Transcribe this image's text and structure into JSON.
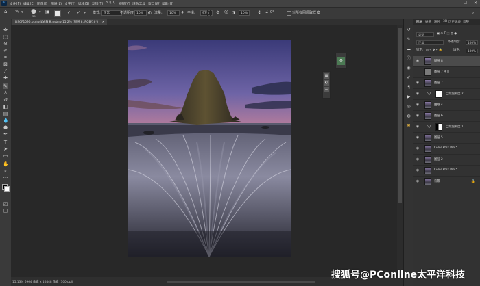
{
  "app": {
    "logo": "Ps"
  },
  "menu": [
    "文件(F)",
    "编辑(E)",
    "图像(I)",
    "图层(L)",
    "文字(Y)",
    "选择(S)",
    "滤镜(T)",
    "3D(D)",
    "视图(V)",
    "增效工具",
    "窗口(W)",
    "帮助(H)"
  ],
  "window_controls": [
    "—",
    "☐",
    "✕"
  ],
  "options": {
    "mode_label": "模式:",
    "mode_value": "正常",
    "opacity_label": "不透明度:",
    "opacity_value": "10%",
    "flow_label": "流量:",
    "flow_value": "10%",
    "smooth_label": "平滑:",
    "smooth_value": "97%",
    "pressure_value": "10%",
    "angle_label": "∠",
    "angle_value": "0°",
    "brush_size": "59",
    "sample_all": "对所有图层取样"
  },
  "document": {
    "tab_title": "DSCF1096.psd@样式效果.psb @ 15.2% (图层 8, RGB/16*)"
  },
  "status": "15.13%  6964 像素 x 10448 像素 (300 ppi)",
  "right_panel": {
    "tabs": [
      "图层",
      "通道",
      "路径",
      "3D",
      "历史记录",
      "调整"
    ],
    "kind_label": "类型",
    "blend_mode": "正常",
    "opacity_label": "不透明度:",
    "opacity_value": "100%",
    "lock_label": "锁定:",
    "fill_label": "填充:",
    "fill_value": "100%"
  },
  "layers": [
    {
      "name": "图层 8",
      "selected": true
    },
    {
      "name": "图层 7 拷贝"
    },
    {
      "name": "图层 7"
    },
    {
      "name": "自然饱和度 2"
    },
    {
      "name": "曲线 4"
    },
    {
      "name": "图层 6"
    },
    {
      "name": "自然饱和度 1"
    },
    {
      "name": "图层 5"
    },
    {
      "name": "Color Efex Pro 5"
    },
    {
      "name": "图层 2"
    },
    {
      "name": "Color Efex Pro 5"
    },
    {
      "name": "背景"
    }
  ],
  "watermark": "搜狐号@PConline太平洋科技"
}
